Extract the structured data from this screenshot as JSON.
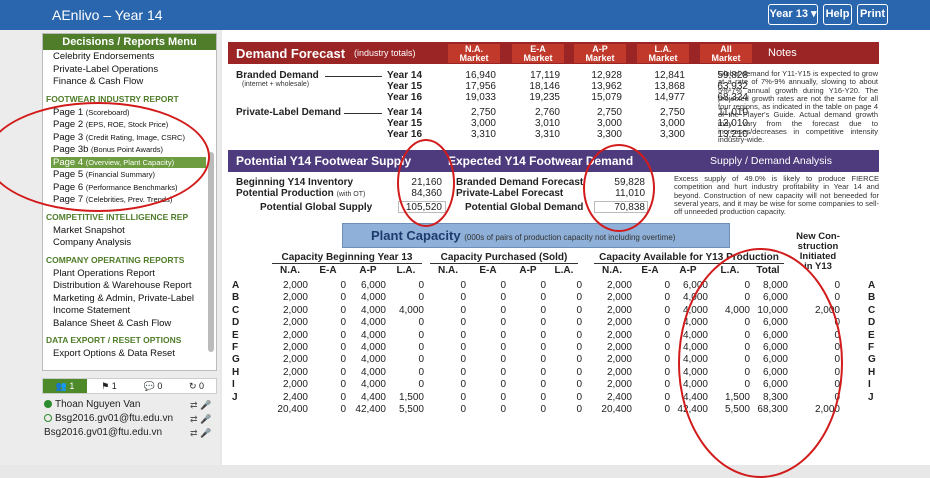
{
  "app": {
    "title": "AEnlivo – Year 14",
    "year_button": "Year 13 ▾",
    "help": "Help",
    "print": "Print"
  },
  "menu": {
    "title": "Decisions / Reports Menu",
    "top_items": [
      "Celebrity Endorsements",
      "Private-Label Operations",
      "Finance & Cash Flow"
    ],
    "sections": [
      {
        "title": "FOOTWEAR INDUSTRY REPORT",
        "items": [
          {
            "label": "Page 1",
            "sub": "(Scoreboard)"
          },
          {
            "label": "Page 2",
            "sub": "(EPS, ROE, Stock Price)"
          },
          {
            "label": "Page 3",
            "sub": "(Credit Rating, Image, CSRC)"
          },
          {
            "label": "Page 3b",
            "sub": "(Bonus Point Awards)"
          },
          {
            "label": "Page 4",
            "sub": "(Overview, Plant Capacity)"
          },
          {
            "label": "Page 5",
            "sub": "(Financial Summary)"
          },
          {
            "label": "Page 6",
            "sub": "(Performance Benchmarks)"
          },
          {
            "label": "Page 7",
            "sub": "(Celebrities, Prev. Trends)"
          }
        ]
      },
      {
        "title": "COMPETITIVE INTELLIGENCE REP",
        "items": [
          {
            "label": "Market Snapshot",
            "sub": ""
          },
          {
            "label": "Company Analysis",
            "sub": ""
          }
        ]
      },
      {
        "title": "COMPANY OPERATING REPORTS",
        "items": [
          {
            "label": "Plant Operations Report",
            "sub": ""
          },
          {
            "label": "Distribution & Warehouse Report",
            "sub": ""
          },
          {
            "label": "Marketing & Admin, Private-Label",
            "sub": ""
          },
          {
            "label": "Income Statement",
            "sub": ""
          },
          {
            "label": "Balance Sheet & Cash Flow",
            "sub": ""
          }
        ]
      },
      {
        "title": "DATA EXPORT / RESET OPTIONS",
        "items": [
          {
            "label": "Export Options & Data Reset",
            "sub": ""
          }
        ]
      }
    ]
  },
  "chat_tabs": [
    "👥 1",
    "⚑ 1",
    "💬 0",
    "↻ 0"
  ],
  "users": [
    {
      "name": "Thoan Nguyen Van",
      "status": "online"
    },
    {
      "name": "Bsg2016.gv01@ftu.edu.vn",
      "status": "offline"
    },
    {
      "name": "Bsg2016.gv01@ftu.edu.vn",
      "status": "none"
    }
  ],
  "demand": {
    "title": "Demand Forecast",
    "subtitle": "(industry totals)",
    "markets": [
      "N.A.\nMarket",
      "E-A\nMarket",
      "A-P\nMarket",
      "L.A.\nMarket",
      "All\nMarket"
    ],
    "notes_label": "Notes",
    "branded_label": "Branded Demand",
    "branded_sub": "(internet + wholesale)",
    "private_label": "Private-Label Demand",
    "years": [
      "Year 14",
      "Year 15",
      "Year 16"
    ],
    "branded_rows": [
      [
        "16,940",
        "17,119",
        "12,928",
        "12,841",
        "59,828"
      ],
      [
        "17,956",
        "18,146",
        "13,962",
        "13,868",
        "63,932"
      ],
      [
        "19,033",
        "19,235",
        "15,079",
        "14,977",
        "68,324"
      ]
    ],
    "private_rows": [
      [
        "2,750",
        "2,760",
        "2,750",
        "2,750",
        "11,010"
      ],
      [
        "3,000",
        "3,010",
        "3,000",
        "3,000",
        "12,010"
      ],
      [
        "3,310",
        "3,310",
        "3,300",
        "3,300",
        "13,210"
      ]
    ],
    "notes": "Global demand for Y11-Y15 is expected to grow at a rate of 7%-9% annually, slowing to about 5%-7% annual growth during Y16-Y20. The projected growth rates are not the same for all four regions, as indicated in the table on page 4 of the Player's Guide. Actual demand growth may vary from the forecast due to increases/decreases in competitive intensity industry-wide."
  },
  "supply": {
    "title": "Potential Y14 Footwear Supply",
    "demand_title": "Expected Y14 Footwear Demand",
    "analysis_title": "Supply / Demand Analysis",
    "beginning_label": "Beginning Y14 Inventory",
    "beginning": "21,160",
    "production_label": "Potential Production",
    "production_note": "(with OT)",
    "production": "84,360",
    "global_label": "Potential Global Supply",
    "global": "105,520",
    "branded_label": "Branded Demand Forecast",
    "branded": "59,828",
    "private_label": "Private-Label Forecast",
    "private": "11,010",
    "gdemand_label": "Potential Global Demand",
    "gdemand": "70,838",
    "analysis": "Excess supply of 49.0% is likely to produce FIERCE competition and hurt industry profitability in Year 14 and beyond. Construction of new capacity will not beneeded for several years, and it may be wise for some companies to sell-off unneeded production capacity."
  },
  "plant": {
    "title": "Plant Capacity",
    "subtitle": "(000s of pairs of production capacity not including overtime)",
    "group1": "Capacity Beginning Year 13",
    "group2": "Capacity Purchased (Sold)",
    "group3": "Capacity Available for Y13 Production",
    "new_con": "New Con-\nstruction\nInitiated\nin Y13",
    "cols": [
      "N.A.",
      "E-A",
      "A-P",
      "L.A.",
      "Total"
    ],
    "companies": [
      "A",
      "B",
      "C",
      "D",
      "E",
      "F",
      "G",
      "H",
      "I",
      "J"
    ],
    "begin": [
      [
        "2,000",
        "0",
        "6,000",
        "0"
      ],
      [
        "2,000",
        "0",
        "4,000",
        "0"
      ],
      [
        "2,000",
        "0",
        "4,000",
        "4,000"
      ],
      [
        "2,000",
        "0",
        "4,000",
        "0"
      ],
      [
        "2,000",
        "0",
        "4,000",
        "0"
      ],
      [
        "2,000",
        "0",
        "4,000",
        "0"
      ],
      [
        "2,000",
        "0",
        "4,000",
        "0"
      ],
      [
        "2,000",
        "0",
        "4,000",
        "0"
      ],
      [
        "2,000",
        "0",
        "4,000",
        "0"
      ],
      [
        "2,400",
        "0",
        "4,400",
        "1,500"
      ],
      [
        "20,400",
        "0",
        "42,400",
        "5,500"
      ]
    ],
    "purchased": [
      [
        "0",
        "0",
        "0",
        "0"
      ],
      [
        "0",
        "0",
        "0",
        "0"
      ],
      [
        "0",
        "0",
        "0",
        "0"
      ],
      [
        "0",
        "0",
        "0",
        "0"
      ],
      [
        "0",
        "0",
        "0",
        "0"
      ],
      [
        "0",
        "0",
        "0",
        "0"
      ],
      [
        "0",
        "0",
        "0",
        "0"
      ],
      [
        "0",
        "0",
        "0",
        "0"
      ],
      [
        "0",
        "0",
        "0",
        "0"
      ],
      [
        "0",
        "0",
        "0",
        "0"
      ],
      [
        "0",
        "0",
        "0",
        "0"
      ]
    ],
    "available": [
      [
        "2,000",
        "0",
        "6,000",
        "0",
        "8,000"
      ],
      [
        "2,000",
        "0",
        "4,000",
        "0",
        "6,000"
      ],
      [
        "2,000",
        "0",
        "4,000",
        "4,000",
        "10,000"
      ],
      [
        "2,000",
        "0",
        "4,000",
        "0",
        "6,000"
      ],
      [
        "2,000",
        "0",
        "4,000",
        "0",
        "6,000"
      ],
      [
        "2,000",
        "0",
        "4,000",
        "0",
        "6,000"
      ],
      [
        "2,000",
        "0",
        "4,000",
        "0",
        "6,000"
      ],
      [
        "2,000",
        "0",
        "4,000",
        "0",
        "6,000"
      ],
      [
        "2,000",
        "0",
        "4,000",
        "0",
        "6,000"
      ],
      [
        "2,400",
        "0",
        "4,400",
        "1,500",
        "8,300"
      ],
      [
        "20,400",
        "0",
        "42,400",
        "5,500",
        "68,300"
      ]
    ],
    "new_construction": [
      "0",
      "0",
      "2,000",
      "0",
      "0",
      "0",
      "0",
      "0",
      "0",
      "0",
      "2,000"
    ]
  },
  "colors": {
    "topbar": "#2a66ad",
    "menu_green": "#4f7d2a",
    "demand_red": "#9b2525",
    "market_red": "#c0392b",
    "supply_purple": "#4e3b7e",
    "plant_blue": "#8fb0d8",
    "annotation_red": "#d21b1b"
  }
}
